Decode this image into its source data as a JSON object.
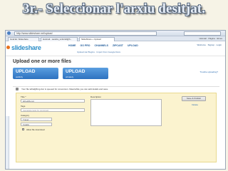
{
  "slide": {
    "title": "3r.- Seleccionar l'arxiu desitjat."
  },
  "browser": {
    "url": "http://www.slideshare.net/upload",
    "tabs": [
      "Grail Et: Slideshare",
      "Hotmail - sandra_snbcrsll@h...",
      "SlideShare + Upload"
    ],
    "toolbar_right": "Hotmail · Pàgina · Eines"
  },
  "slideshare": {
    "logo": "slideshare",
    "nav": [
      "HOME",
      "GO PRO",
      "CHANNELS",
      "ZIPCAST",
      "UPLOAD"
    ],
    "upload_links": "Upload via Plugins · Import from Google Docs",
    "top_right": "Welcome · Signup · Login"
  },
  "upload_page": {
    "heading": "Upload one or more files",
    "btn_public": "UPLOAD",
    "btn_public_sub": "publicly",
    "btn_private": "UPLOAD",
    "btn_private_sub": "privately",
    "trouble_link": "Trouble uploading?",
    "status": "Your file tafrafgflimg.doc is queued for conversion. Meanwhile you can add details and save.",
    "title_label": "Title *",
    "title_value": "EjhekjRenoj",
    "description_label": "Description",
    "tags_label": "Tags",
    "tags_placeholder": "(separate tags by commas)",
    "category_label": "Category",
    "category_value": "Travel",
    "language_value": "Català",
    "allow_download": "Allow file download",
    "publish_button": "Save & Publish",
    "delete_link": "Delete"
  }
}
